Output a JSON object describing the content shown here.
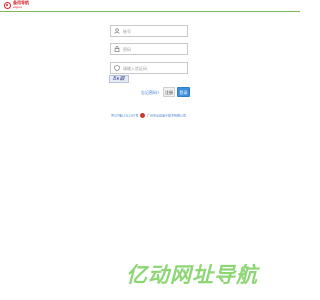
{
  "header": {
    "logo_text_cn": "备用导航",
    "logo_text_en": "elignet"
  },
  "login": {
    "username_placeholder": "账号",
    "password_placeholder": "密码",
    "captcha_placeholder": "请输入验证码",
    "captcha_text": "Бк鍜",
    "forgot_label": "忘记密码?",
    "register_label": "注册",
    "login_button_label": "登录"
  },
  "footer": {
    "icp_text": "粤ICP备12312187号",
    "company_text": "广州市云边电子技术有限公司"
  },
  "watermark": {
    "text": "亿动网址导航"
  },
  "colors": {
    "accent": "#3d8fe0",
    "brand_red": "#d8262c",
    "header_line": "#7fb955",
    "watermark": "#7ad05e"
  }
}
